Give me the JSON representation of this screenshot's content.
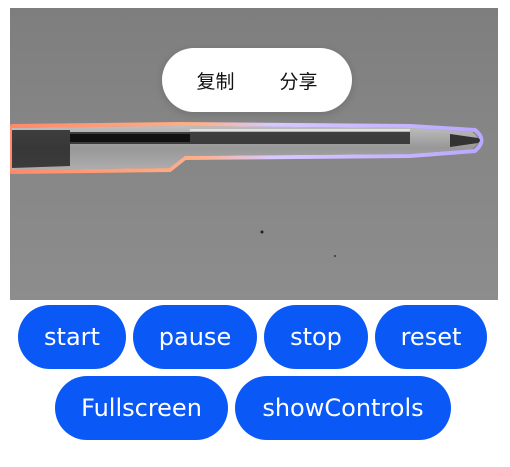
{
  "context_menu": {
    "copy_label": "复制",
    "share_label": "分享"
  },
  "controls": {
    "start_label": "start",
    "pause_label": "pause",
    "stop_label": "stop",
    "reset_label": "reset",
    "fullscreen_label": "Fullscreen",
    "show_controls_label": "showControls"
  },
  "colors": {
    "button_bg": "#0a59f7",
    "button_text": "#ffffff",
    "menu_bg": "#ffffff",
    "subject_outline_warm": "#ff8a6a",
    "subject_outline_cool": "#b9a8ff"
  },
  "media": {
    "subject": "pen-photo"
  }
}
